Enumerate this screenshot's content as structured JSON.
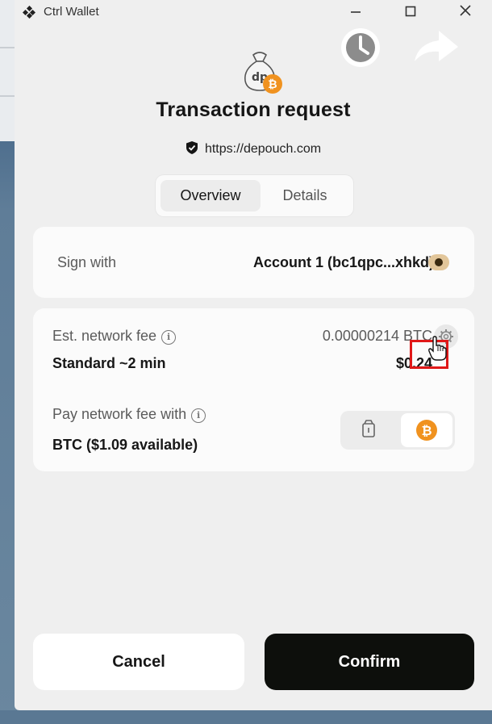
{
  "window": {
    "title": "Ctrl Wallet"
  },
  "header": {
    "title": "Transaction request",
    "site_url": "https://depouch.com"
  },
  "tabs": [
    {
      "label": "Overview",
      "active": true
    },
    {
      "label": "Details",
      "active": false
    }
  ],
  "sign": {
    "label": "Sign with",
    "account": "Account 1 (bc1qpc...xhkd)"
  },
  "fee": {
    "label": "Est. network fee",
    "btc_amount": "0.00000214 BTC",
    "speed": "Standard ~2 min",
    "usd_amount": "$0.24"
  },
  "pay_fee": {
    "label": "Pay network fee with",
    "value": "BTC ($1.09  available)",
    "options": [
      "pouch-icon",
      "bitcoin-icon"
    ],
    "selected": "bitcoin-icon"
  },
  "actions": {
    "cancel_label": "Cancel",
    "confirm_label": "Confirm"
  },
  "colors": {
    "accent_btc": "#f0921f",
    "highlight": "#e01818",
    "confirm_bg": "#0d0f0c"
  }
}
